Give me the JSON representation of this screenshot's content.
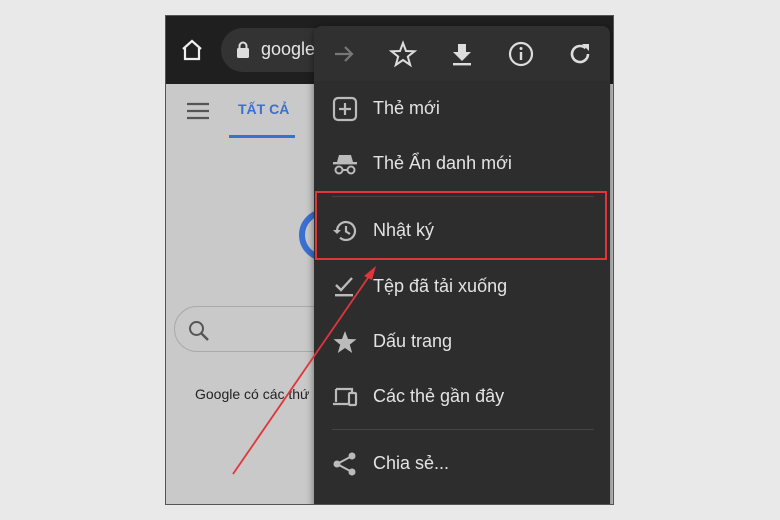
{
  "browser": {
    "url": "google",
    "tab_label": "TẤT CẢ",
    "page_text": "Google có các thứ"
  },
  "menu": {
    "top_icons": [
      "forward-icon",
      "star-icon",
      "download-icon",
      "info-icon",
      "reload-icon"
    ],
    "items": [
      {
        "label": "Thẻ mới",
        "icon": "new-tab-icon"
      },
      {
        "label": "Thẻ Ẩn danh mới",
        "icon": "incognito-icon"
      },
      {
        "label": "Nhật ký",
        "icon": "history-icon",
        "highlighted": true
      },
      {
        "label": "Tệp đã tải xuống",
        "icon": "downloads-icon"
      },
      {
        "label": "Dấu trang",
        "icon": "bookmark-star-icon"
      },
      {
        "label": "Các thẻ gần đây",
        "icon": "devices-icon"
      },
      {
        "label": "Chia sẻ...",
        "icon": "share-icon"
      }
    ]
  },
  "colors": {
    "highlight": "#e0353b",
    "accent": "#3b6fd0",
    "menu_bg": "#2d2d2d"
  }
}
